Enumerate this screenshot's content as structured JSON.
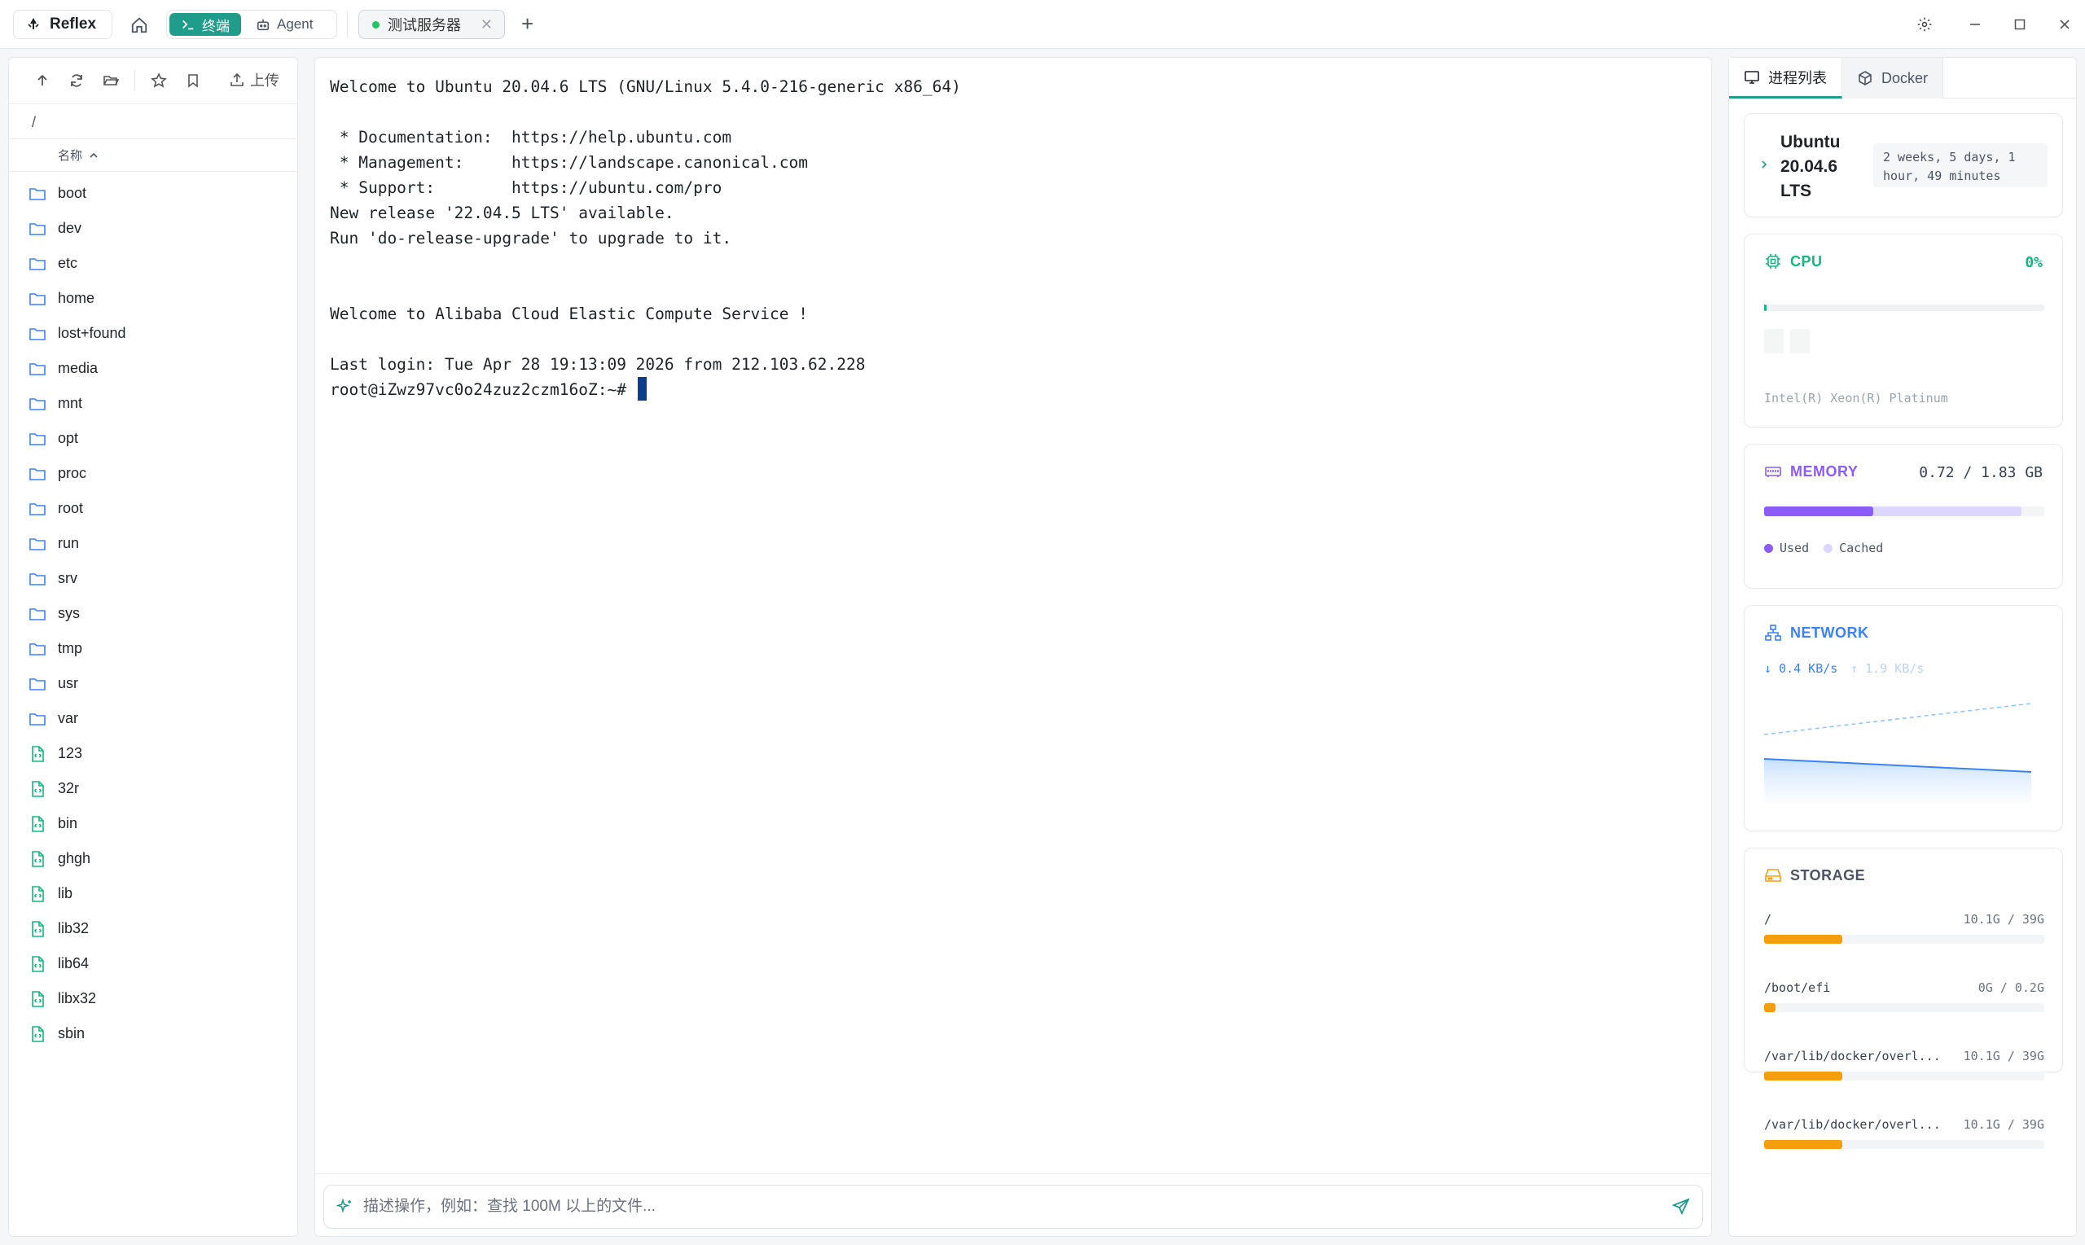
{
  "app": {
    "brand": "Reflex",
    "modes": [
      {
        "label": "终端",
        "active": true
      },
      {
        "label": "Agent",
        "active": false
      }
    ],
    "tab": {
      "label": "测试服务器"
    }
  },
  "files": {
    "upload_label": "上传",
    "path": "/",
    "column_name": "名称",
    "items": [
      {
        "name": "boot",
        "type": "folder"
      },
      {
        "name": "dev",
        "type": "folder"
      },
      {
        "name": "etc",
        "type": "folder"
      },
      {
        "name": "home",
        "type": "folder"
      },
      {
        "name": "lost+found",
        "type": "folder"
      },
      {
        "name": "media",
        "type": "folder"
      },
      {
        "name": "mnt",
        "type": "folder"
      },
      {
        "name": "opt",
        "type": "folder"
      },
      {
        "name": "proc",
        "type": "folder"
      },
      {
        "name": "root",
        "type": "folder"
      },
      {
        "name": "run",
        "type": "folder"
      },
      {
        "name": "srv",
        "type": "folder"
      },
      {
        "name": "sys",
        "type": "folder"
      },
      {
        "name": "tmp",
        "type": "folder"
      },
      {
        "name": "usr",
        "type": "folder"
      },
      {
        "name": "var",
        "type": "folder"
      },
      {
        "name": "123",
        "type": "file"
      },
      {
        "name": "32r",
        "type": "file"
      },
      {
        "name": "bin",
        "type": "file"
      },
      {
        "name": "ghgh",
        "type": "file"
      },
      {
        "name": "lib",
        "type": "file"
      },
      {
        "name": "lib32",
        "type": "file"
      },
      {
        "name": "lib64",
        "type": "file"
      },
      {
        "name": "libx32",
        "type": "file"
      },
      {
        "name": "sbin",
        "type": "file"
      }
    ]
  },
  "terminal": {
    "lines": [
      "Welcome to Ubuntu 20.04.6 LTS (GNU/Linux 5.4.0-216-generic x86_64)",
      "",
      " * Documentation:  https://help.ubuntu.com",
      " * Management:     https://landscape.canonical.com",
      " * Support:        https://ubuntu.com/pro",
      "New release '22.04.5 LTS' available.",
      "Run 'do-release-upgrade' to upgrade to it.",
      "",
      "",
      "Welcome to Alibaba Cloud Elastic Compute Service !",
      "",
      "Last login: Tue Apr 28 19:13:09 2026 from 212.103.62.228"
    ],
    "prompt": "root@iZwz97vc0o24zuz2czm16oZ:~# ",
    "input_placeholder": "描述操作，例如：查找 100M 以上的文件..."
  },
  "monitor": {
    "tabs": [
      {
        "label": "进程列表",
        "active": true
      },
      {
        "label": "Docker",
        "active": false
      }
    ],
    "system": {
      "os": "Ubuntu 20.04.6 LTS",
      "uptime": "2 weeks, 5 days, 1 hour, 49 minutes"
    },
    "cpu": {
      "label": "CPU",
      "percent_text": "0%",
      "percent": 0.01,
      "model": "Intel(R) Xeon(R) Platinum",
      "color": "#10b981"
    },
    "memory": {
      "label": "MEMORY",
      "value_text": "0.72 / 1.83 GB",
      "used_fraction": 0.39,
      "cached_fraction": 0.92,
      "legend_used": "Used",
      "legend_cached": "Cached",
      "color": "#8b5cf6"
    },
    "network": {
      "label": "NETWORK",
      "down": "0.4 KB/s",
      "up": "1.9 KB/s",
      "color": "#3b82f6"
    },
    "storage": {
      "label": "STORAGE",
      "color": "#f59e0b",
      "items": [
        {
          "mount": "/",
          "usage": "10.1G / 39G",
          "fraction": 0.28
        },
        {
          "mount": "/boot/efi",
          "usage": "0G / 0.2G",
          "fraction": 0.04
        },
        {
          "mount": "/var/lib/docker/overl...",
          "usage": "10.1G / 39G",
          "fraction": 0.28
        },
        {
          "mount": "/var/lib/docker/overl...",
          "usage": "10.1G / 39G",
          "fraction": 0.28
        }
      ]
    }
  }
}
